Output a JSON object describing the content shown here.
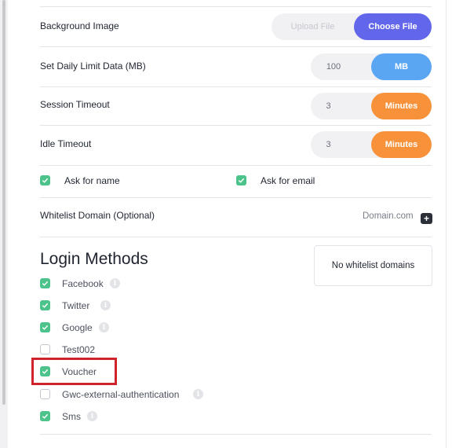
{
  "settings": {
    "background_image": {
      "label": "Background Image",
      "upload_placeholder": "Upload File",
      "choose_button": "Choose File"
    },
    "daily_limit": {
      "label": "Set Daily Limit Data (MB)",
      "value": "100",
      "unit": "MB"
    },
    "session_timeout": {
      "label": "Session Timeout",
      "value": "3",
      "unit": "Minutes"
    },
    "idle_timeout": {
      "label": "Idle Timeout",
      "value": "3",
      "unit": "Minutes"
    },
    "ask_name": {
      "label": "Ask for name",
      "checked": true
    },
    "ask_email": {
      "label": "Ask for email",
      "checked": true
    },
    "whitelist": {
      "label": "Whitelist Domain (Optional)",
      "placeholder": "Domain.com",
      "empty_text": "No whitelist domains"
    }
  },
  "login_methods": {
    "heading": "Login Methods",
    "items": [
      {
        "label": "Facebook",
        "checked": true,
        "info": true
      },
      {
        "label": "Twitter",
        "checked": true,
        "info": true
      },
      {
        "label": "Google",
        "checked": true,
        "info": true
      },
      {
        "label": "Test002",
        "checked": false,
        "info": false
      },
      {
        "label": "Voucher",
        "checked": true,
        "info": false
      },
      {
        "label": "Gwc-external-authentication",
        "checked": false,
        "info": true
      },
      {
        "label": "Sms",
        "checked": true,
        "info": true
      }
    ]
  },
  "colors": {
    "choose_button": "#6266ea",
    "mb_button": "#5aa6f2",
    "minutes_button": "#f7923a",
    "checkbox_on": "#4cc38a",
    "highlight": "#d0222b"
  },
  "icons": {
    "checkbox": "check-mark",
    "info": "info-circle",
    "add": "plus-square"
  }
}
